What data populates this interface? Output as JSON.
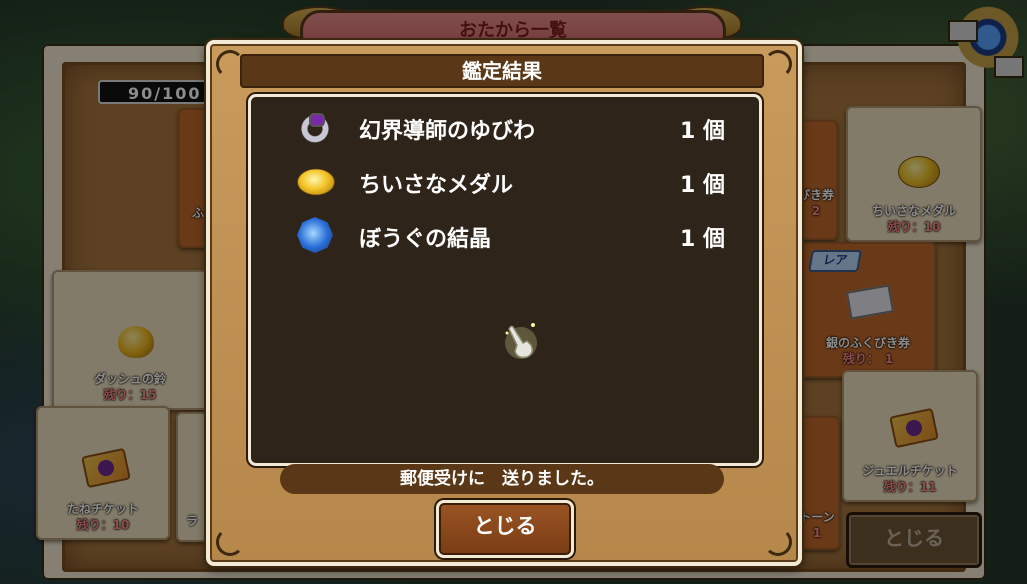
{
  "background": {
    "title": "おたから一覧",
    "counter": "90/100",
    "close_label": "とじる",
    "rare_tag": "レア",
    "cards": {
      "dash_bell": {
        "name": "ダッシュの鈴",
        "remaining": "残り：15"
      },
      "seed_ticket": {
        "name": "たねチケット",
        "remaining": "残り：10"
      },
      "small_medal": {
        "name": "ちいさなメダル",
        "remaining": "残り：10"
      },
      "silver_ticket": {
        "name": "銀のふくびき券",
        "remaining": "残り：　1"
      },
      "jewel_ticket": {
        "name": "ジュエルチケット",
        "remaining": "残り：11"
      },
      "partial_left": "ふ",
      "partial_left2": "ラ",
      "partial_right_top": "びき券",
      "partial_right_top_rem": "2",
      "partial_right_bottom": "トーン",
      "partial_right_bottom_rem": "1"
    }
  },
  "dialog": {
    "title": "鑑定結果",
    "results": [
      {
        "icon": "ring-icon",
        "name": "幻界導師のゆびわ",
        "qty": "1 個"
      },
      {
        "icon": "medal-icon",
        "name": "ちいさなメダル",
        "qty": "1 個"
      },
      {
        "icon": "crystal-icon",
        "name": "ぼうぐの結晶",
        "qty": "1 個"
      }
    ],
    "message": "郵便受けに　送りました。",
    "close_label": "とじる"
  },
  "colors": {
    "panel_dark": "#2e241a",
    "frame_light": "#f3ead6",
    "bar_brown": "#5a3716",
    "button_brown": "#8a4a1c"
  }
}
